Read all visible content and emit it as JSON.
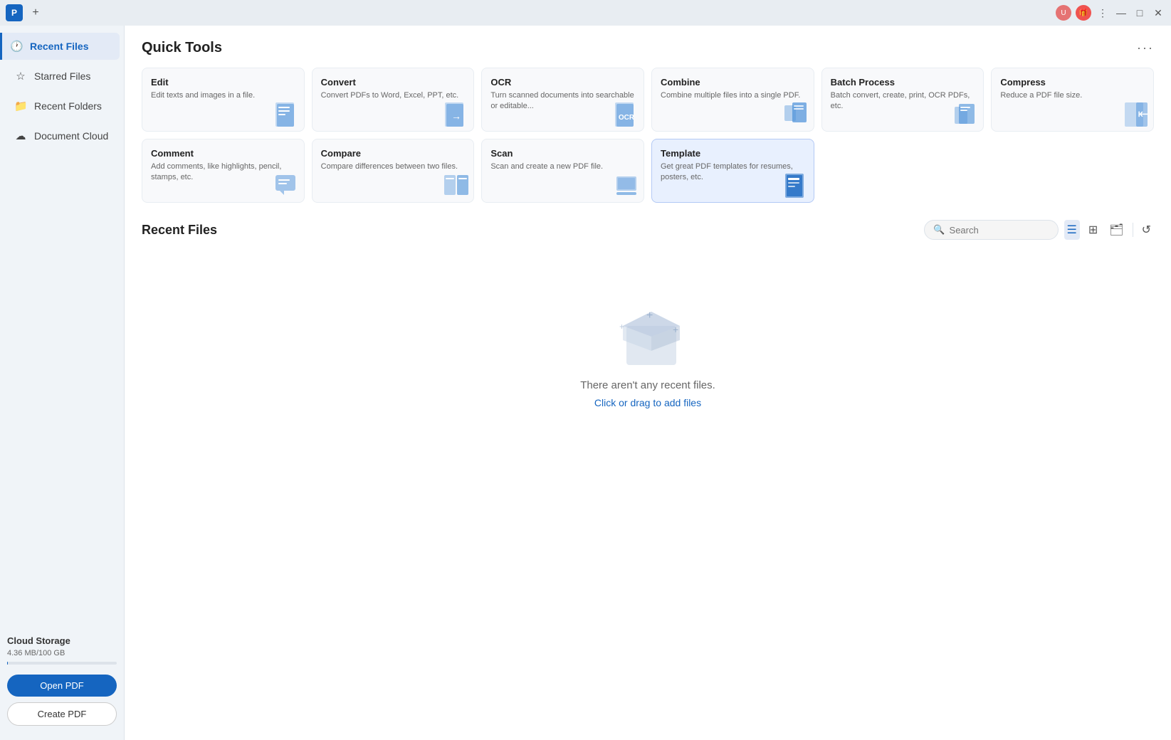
{
  "titleBar": {
    "addTab": "+",
    "moreMenu": "⋮",
    "minimize": "—",
    "maximize": "□",
    "close": "✕"
  },
  "sidebar": {
    "items": [
      {
        "id": "recent-files",
        "label": "Recent Files",
        "icon": "🕐",
        "active": true
      },
      {
        "id": "starred-files",
        "label": "Starred Files",
        "icon": "☆",
        "active": false
      },
      {
        "id": "recent-folders",
        "label": "Recent Folders",
        "icon": "📁",
        "active": false
      },
      {
        "id": "document-cloud",
        "label": "Document Cloud",
        "icon": "☁",
        "active": false
      }
    ],
    "cloudStorage": {
      "label": "Cloud Storage",
      "amount": "4.36 MB/100 GB"
    },
    "buttons": {
      "openPdf": "Open PDF",
      "createPdf": "Create PDF"
    }
  },
  "quickTools": {
    "title": "Quick Tools",
    "moreIcon": "···",
    "tools": [
      {
        "id": "edit",
        "title": "Edit",
        "description": "Edit texts and images in a file.",
        "highlighted": false
      },
      {
        "id": "convert",
        "title": "Convert",
        "description": "Convert PDFs to Word, Excel, PPT, etc.",
        "highlighted": false
      },
      {
        "id": "ocr",
        "title": "OCR",
        "description": "Turn scanned documents into searchable or editable...",
        "highlighted": false
      },
      {
        "id": "combine",
        "title": "Combine",
        "description": "Combine multiple files into a single PDF.",
        "highlighted": false
      },
      {
        "id": "batch-process",
        "title": "Batch Process",
        "description": "Batch convert, create, print, OCR PDFs, etc.",
        "highlighted": false
      },
      {
        "id": "compress",
        "title": "Compress",
        "description": "Reduce a PDF file size.",
        "highlighted": false
      },
      {
        "id": "comment",
        "title": "Comment",
        "description": "Add comments, like highlights, pencil, stamps, etc.",
        "highlighted": false
      },
      {
        "id": "compare",
        "title": "Compare",
        "description": "Compare differences between two files.",
        "highlighted": false
      },
      {
        "id": "scan",
        "title": "Scan",
        "description": "Scan and create a new PDF file.",
        "highlighted": false
      },
      {
        "id": "template",
        "title": "Template",
        "description": "Get great PDF templates for resumes, posters, etc.",
        "highlighted": true
      }
    ]
  },
  "recentFiles": {
    "title": "Recent Files",
    "searchPlaceholder": "Search",
    "emptyState": {
      "message": "There aren't any recent files.",
      "linkText": "Click or drag",
      "linkSuffix": " to add files"
    }
  }
}
